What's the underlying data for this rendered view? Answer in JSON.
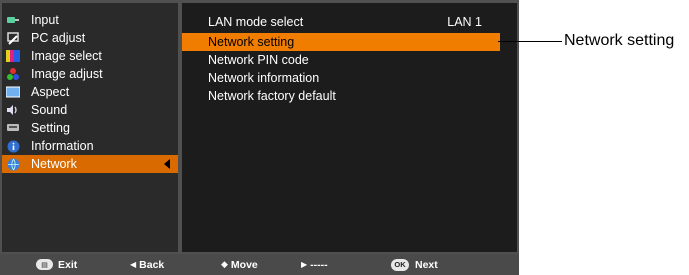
{
  "sidebar": {
    "items": [
      {
        "label": "Input",
        "icon": "input-icon"
      },
      {
        "label": "PC adjust",
        "icon": "pc-adjust-icon"
      },
      {
        "label": "Image select",
        "icon": "image-select-icon"
      },
      {
        "label": "Image adjust",
        "icon": "image-adjust-icon"
      },
      {
        "label": "Aspect",
        "icon": "aspect-icon"
      },
      {
        "label": "Sound",
        "icon": "sound-icon"
      },
      {
        "label": "Setting",
        "icon": "setting-icon"
      },
      {
        "label": "Information",
        "icon": "information-icon"
      },
      {
        "label": "Network",
        "icon": "network-icon",
        "selected": true
      }
    ]
  },
  "content": {
    "rows": [
      {
        "label": "LAN mode select",
        "value": "LAN 1"
      },
      {
        "label": "Network setting",
        "selected": true
      },
      {
        "label": "Network PIN code"
      },
      {
        "label": "Network information"
      },
      {
        "label": "Network factory default"
      }
    ]
  },
  "footer": {
    "exit": "Exit",
    "back": "Back",
    "move": "Move",
    "next_arrow": "-----",
    "next": "Next",
    "ok_key": "OK"
  },
  "callout": {
    "label": "Network setting"
  },
  "colors": {
    "selected_row": "#f07c00",
    "selected_sidebar": "#d86a00",
    "panel": "#1c1c1c"
  }
}
